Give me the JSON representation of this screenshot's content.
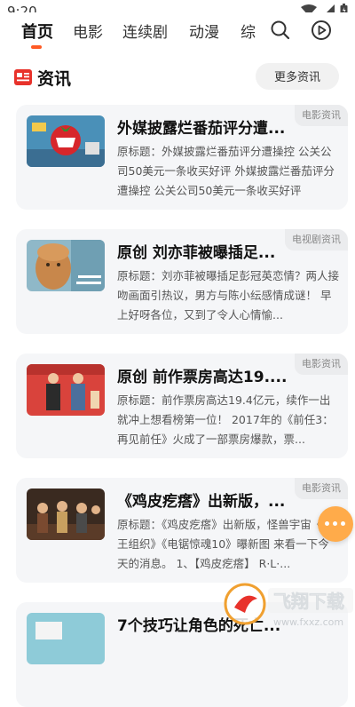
{
  "status": {
    "time": "9:20"
  },
  "tabs": [
    {
      "label": "首页",
      "active": true
    },
    {
      "label": "电影"
    },
    {
      "label": "连续剧"
    },
    {
      "label": "动漫"
    },
    {
      "label": "综"
    }
  ],
  "section": {
    "title": "资讯",
    "more_label": "更多资讯"
  },
  "news": [
    {
      "title": "外媒披露烂番茄评分遭...",
      "tag": "电影资讯",
      "desc": "原标题：外媒披露烂番茄评分遭操控 公关公司50美元一条收买好评 外媒披露烂番茄评分遭操控 公关公司50美元一条收买好评"
    },
    {
      "title": "原创 刘亦菲被曝插足...",
      "tag": "电视剧资讯",
      "desc": "原标题：刘亦菲被曝插足彭冠英恋情？两人接吻画面引热议，男方与陈小纭感情成谜！ 早上好呀各位，又到了令人心情愉..."
    },
    {
      "title": "原创 前作票房高达19....",
      "tag": "电影资讯",
      "desc": "原标题：前作票房高达19.4亿元，续作一出就冲上想看榜第一位！ 2017年的《前任3：再见前任》火成了一部票房爆款，票..."
    },
    {
      "title": "《鸡皮疙瘩》出新版，...",
      "tag": "电影资讯",
      "desc": "原标题：《鸡皮疙瘩》出新版，怪兽宇宙《帝王组织》《电锯惊魂10》曝新图 来看一下今天的消息。 1、【鸡皮疙瘩】 R·L·..."
    },
    {
      "title": "7个技巧让角色的死亡...",
      "tag": "",
      "desc": ""
    }
  ],
  "watermark": {
    "brand": "飞翔下载",
    "site": "www.fxxz.com"
  },
  "colors": {
    "accent": "#ff5a24",
    "card_bg": "#f5f6f8",
    "float": "#ffab4a"
  }
}
